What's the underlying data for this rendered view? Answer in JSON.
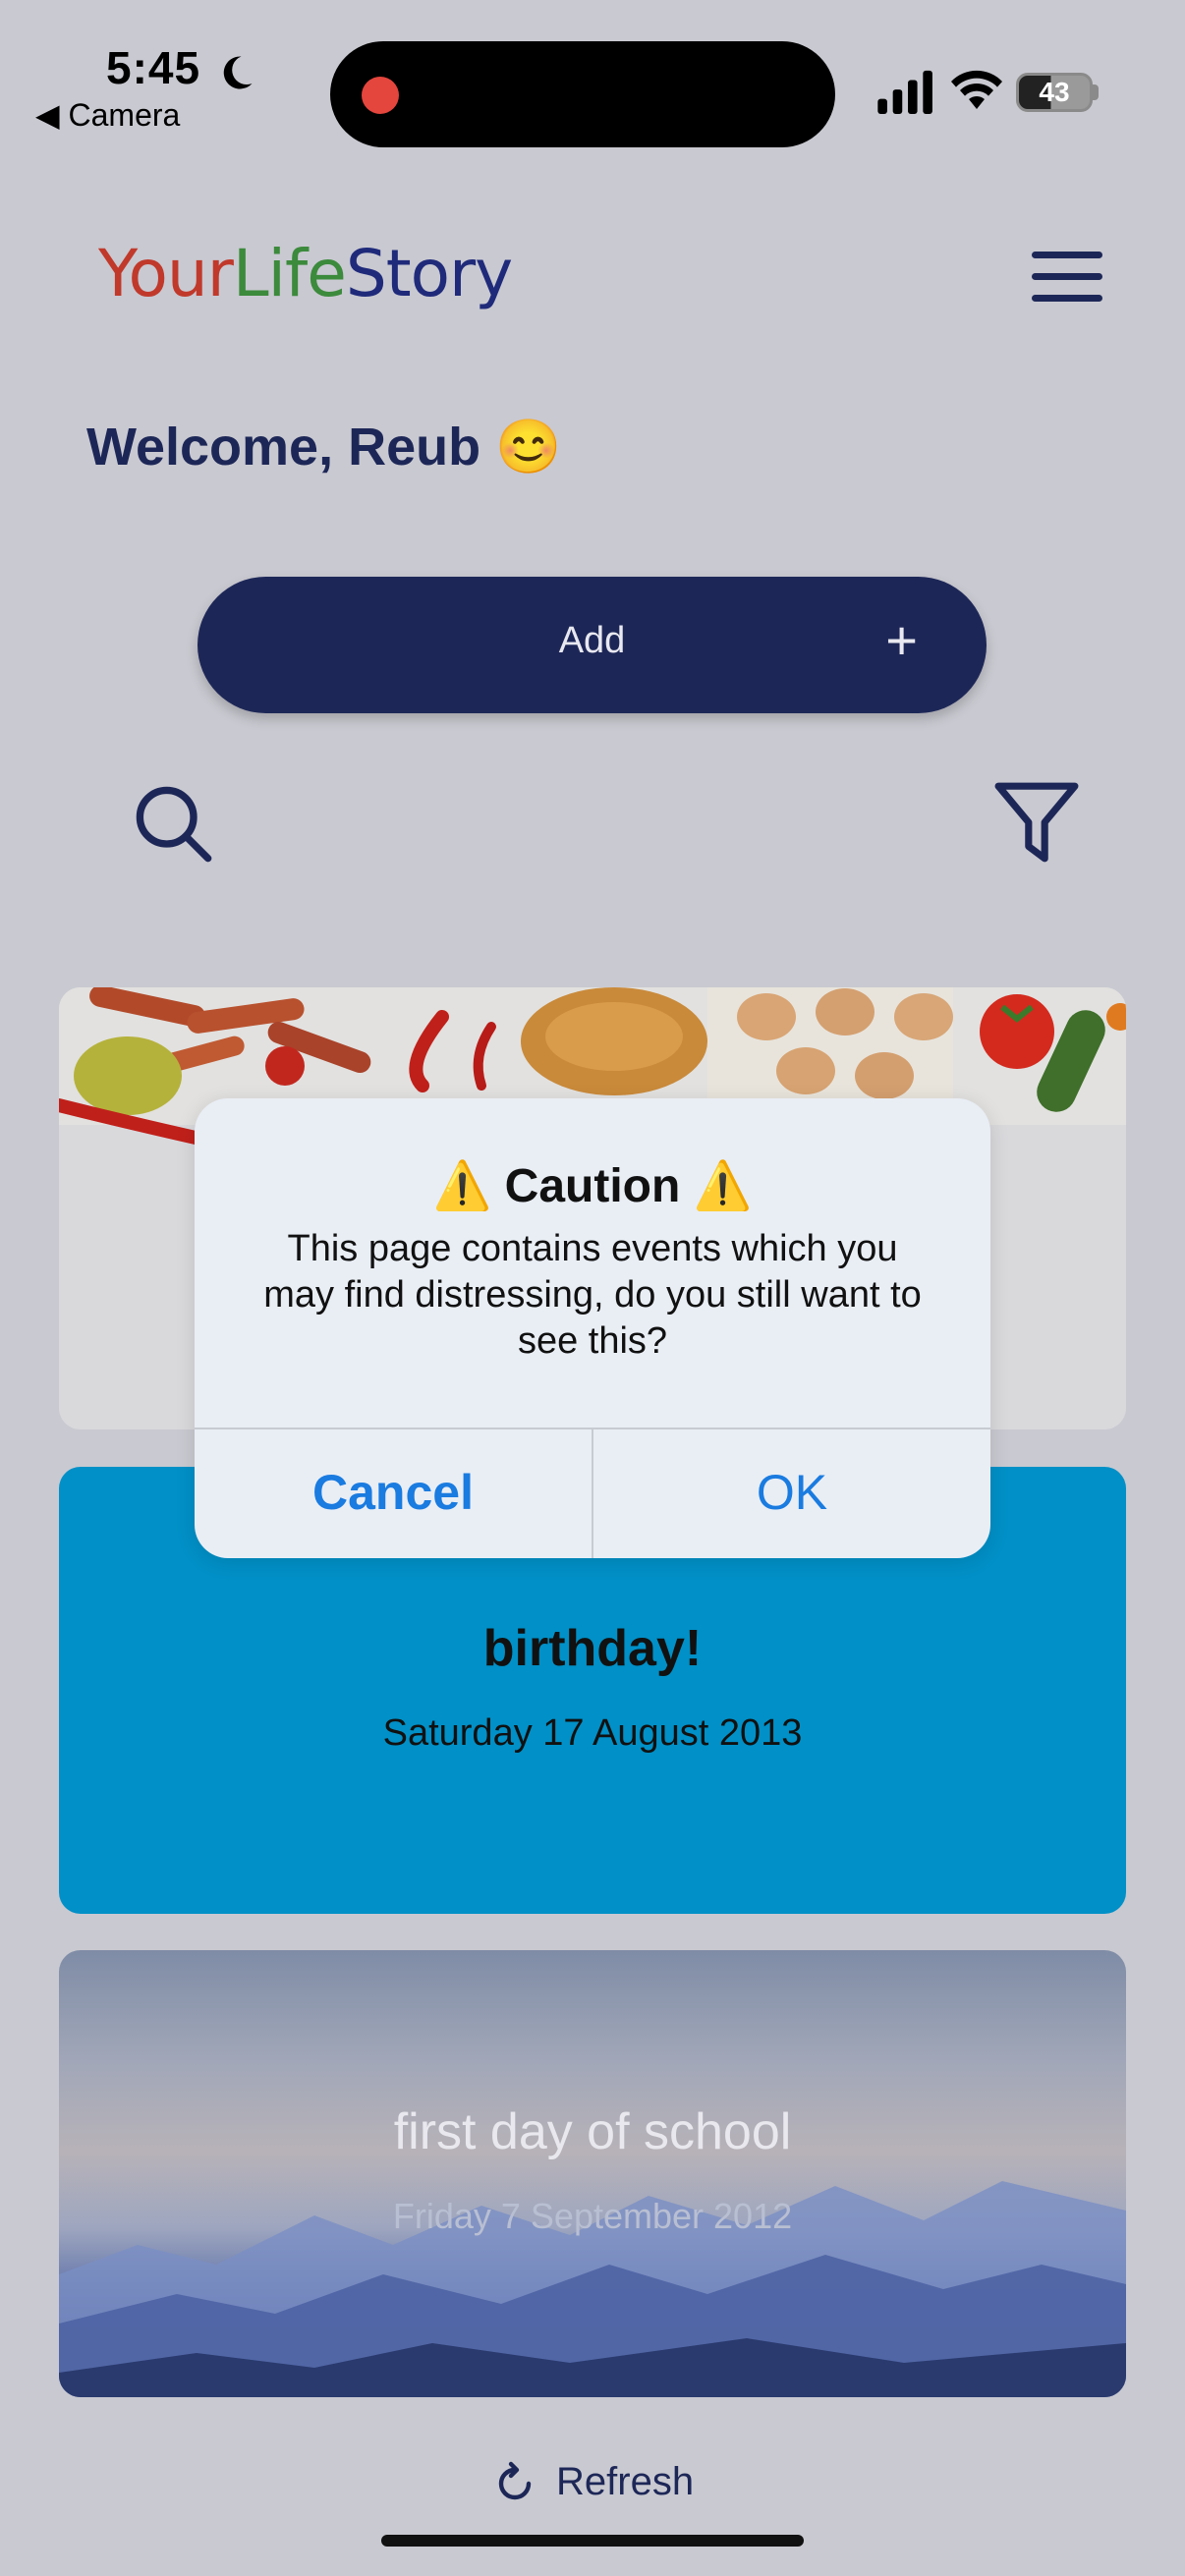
{
  "status_bar": {
    "time": "5:45",
    "back_app": "◀ Camera",
    "battery": "43"
  },
  "header": {
    "logo_part1": "Your",
    "logo_part2": "Life",
    "logo_part3": "Story",
    "menu_icon": "hamburger-menu-icon"
  },
  "welcome": "Welcome, Reub 😊",
  "add_button": {
    "label": "Add",
    "icon": "+"
  },
  "toolbar": {
    "search_icon": "search-icon",
    "filter_icon": "filter-icon"
  },
  "events": [
    {
      "title": "",
      "date": ""
    },
    {
      "title": "birthday!",
      "date": "Saturday 17 August 2013"
    },
    {
      "title": "first day of school",
      "date": "Friday 7 September 2012"
    }
  ],
  "dialog": {
    "title": "⚠️ Caution ⚠️",
    "message": "This page contains events which you may find distressing, do you still want to see this?",
    "cancel_label": "Cancel",
    "ok_label": "OK"
  },
  "footer": {
    "refresh_label": "Refresh"
  },
  "colors": {
    "background": "#c9c9d1",
    "primary": "#1d2757",
    "birthday_card": "#0190c7",
    "dialog_action": "#1a7be0"
  }
}
